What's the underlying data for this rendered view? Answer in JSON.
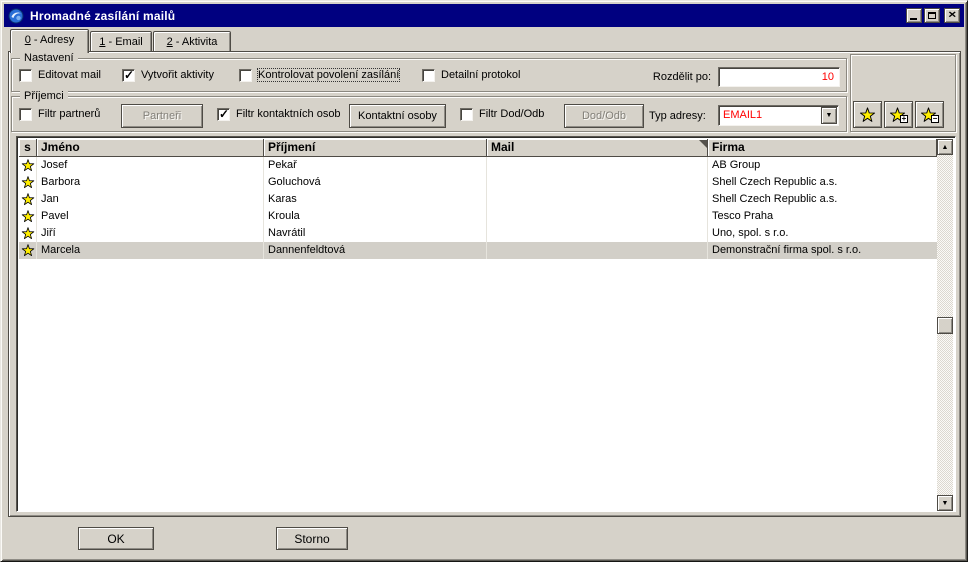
{
  "titlebar": {
    "title": "Hromadné zasílání mailů",
    "close_glyph": "×"
  },
  "tabs": [
    {
      "accel": "0",
      "rest": " - Adresy"
    },
    {
      "accel": "1",
      "rest": " - Email"
    },
    {
      "accel": "2",
      "rest": " - Aktivita"
    }
  ],
  "nastaveni": {
    "label": "Nastavení",
    "cb_editovat": {
      "label": "Editovat mail",
      "checked": false
    },
    "cb_vytvorit": {
      "label": "Vytvořit aktivity",
      "checked": true
    },
    "cb_kontrolovat": {
      "label": "Kontrolovat povolení zasílání",
      "checked": false
    },
    "cb_detailni": {
      "label": "Detailní protokol",
      "checked": false
    },
    "rozdelit_label": "Rozdělit po:",
    "rozdelit_value": "10"
  },
  "prijemci": {
    "label": "Příjemci",
    "cb_partneri": {
      "label": "Filtr partnerů",
      "checked": false
    },
    "btn_partneri": "Partneři",
    "cb_kontaktni": {
      "label": "Filtr kontaktních osob",
      "checked": true
    },
    "btn_kontaktni": "Kontaktní osoby",
    "cb_dododb": {
      "label": "Filtr Dod/Odb",
      "checked": false
    },
    "btn_dododb": "Dod/Odb",
    "typ_adresy_label": "Typ adresy:",
    "typ_adresy_value": "EMAIL1"
  },
  "table": {
    "columns": [
      "s",
      "Jméno",
      "Příjmení",
      "Mail",
      "Firma"
    ],
    "rows": [
      {
        "starred": true,
        "jmeno": "Josef",
        "prijmeni": "Pekař",
        "mail": "",
        "firma": "AB Group",
        "selected": false
      },
      {
        "starred": true,
        "jmeno": "Barbora",
        "prijmeni": "Goluchová",
        "mail": "",
        "firma": "Shell Czech Republic a.s.",
        "selected": false
      },
      {
        "starred": true,
        "jmeno": "Jan",
        "prijmeni": "Karas",
        "mail": "",
        "firma": "Shell Czech Republic a.s.",
        "selected": false
      },
      {
        "starred": true,
        "jmeno": "Pavel",
        "prijmeni": "Kroula",
        "mail": "",
        "firma": "Tesco Praha",
        "selected": false
      },
      {
        "starred": true,
        "jmeno": "Jiří",
        "prijmeni": "Navrátil",
        "mail": "",
        "firma": "Uno, spol. s r.o.",
        "selected": false
      },
      {
        "starred": true,
        "jmeno": "Marcela",
        "prijmeni": "Dannenfeldtová",
        "mail": "",
        "firma": "Demonstrační firma spol. s r.o.",
        "selected": true
      }
    ]
  },
  "footer": {
    "ok": "OK",
    "storno": "Storno"
  },
  "icons": {
    "plus": "+",
    "minus": "−",
    "dropdown": "▼",
    "scroll_up": "▲",
    "scroll_down": "▼"
  },
  "colors": {
    "titlebar": "#000080",
    "accent_red": "#ff0000",
    "star_yellow": "#ffee00",
    "face": "#d6d2c9",
    "selected_row": "#d2cfc8"
  }
}
